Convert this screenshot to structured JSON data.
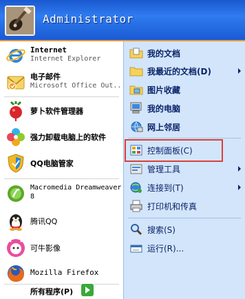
{
  "user": {
    "name": "Administrator"
  },
  "left_items": [
    {
      "title": "Internet",
      "subtitle": "Internet Explorer",
      "icon": "internet-explorer-icon"
    },
    {
      "title": "电子邮件",
      "subtitle": "Microsoft Office Out...",
      "icon": "outlook-mail-icon"
    },
    {
      "title": "萝卜软件管理器",
      "icon": "radish-icon"
    },
    {
      "title": "强力卸载电脑上的软件",
      "icon": "uninstall-flower-icon"
    },
    {
      "title": "QQ电脑管家",
      "icon": "qq-guard-shield-icon"
    },
    {
      "title": "Macromedia Dreamweaver",
      "title2": "8",
      "icon": "dreamweaver-icon"
    },
    {
      "title": "腾讯QQ",
      "icon": "qq-penguin-icon"
    },
    {
      "title": "可牛影像",
      "icon": "keniu-image-icon"
    },
    {
      "title": "Mozilla Firefox",
      "icon": "firefox-icon"
    }
  ],
  "all_programs": {
    "label": "所有程序(P)"
  },
  "right_items": [
    {
      "label": "我的文档",
      "icon": "my-documents-icon",
      "bold": true,
      "arrow": false
    },
    {
      "label": "我最近的文档(D)",
      "icon": "recent-documents-icon",
      "bold": true,
      "arrow": true
    },
    {
      "label": "图片收藏",
      "icon": "my-pictures-icon",
      "bold": true,
      "arrow": false
    },
    {
      "label": "我的电脑",
      "icon": "my-computer-icon",
      "bold": true,
      "arrow": false
    },
    {
      "label": "网上邻居",
      "icon": "network-places-icon",
      "bold": true,
      "arrow": false
    },
    {
      "label": "控制面板(C)",
      "icon": "control-panel-icon",
      "bold": false,
      "arrow": false
    },
    {
      "label": "管理工具",
      "icon": "admin-tools-icon",
      "bold": false,
      "arrow": true
    },
    {
      "label": "连接到(T)",
      "icon": "connect-to-icon",
      "bold": false,
      "arrow": true
    },
    {
      "label": "打印机和传真",
      "icon": "printers-icon",
      "bold": false,
      "arrow": false
    },
    {
      "label": "搜索(S)",
      "icon": "search-icon",
      "bold": false,
      "arrow": false
    },
    {
      "label": "运行(R)...",
      "icon": "run-icon",
      "bold": false,
      "arrow": false
    }
  ],
  "colors": {
    "header_blue": "#2f7bf0",
    "right_panel": "#d3e5fa",
    "highlight_box": "#d9403a",
    "accent_orange": "#e79b3d"
  }
}
